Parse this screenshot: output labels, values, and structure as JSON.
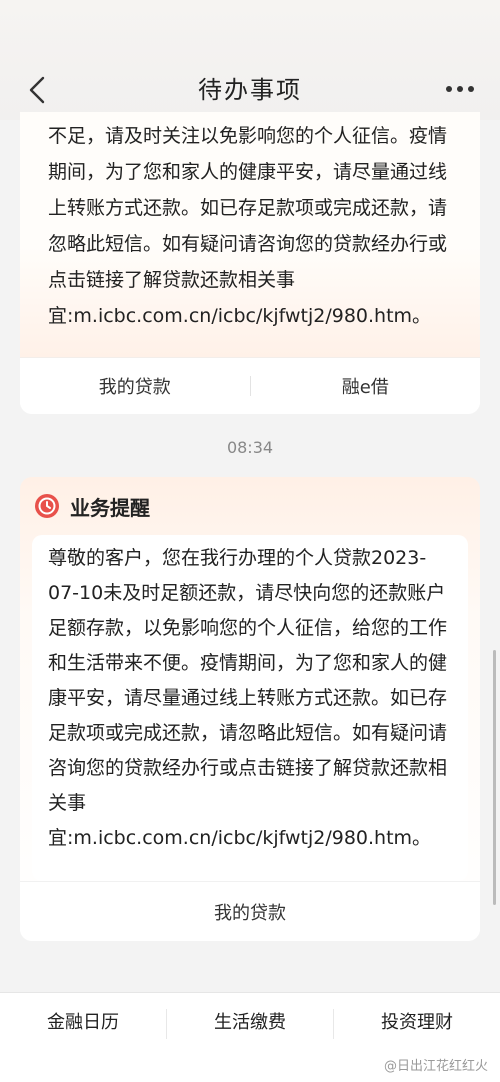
{
  "header": {
    "title": "待办事项"
  },
  "card1": {
    "text": "不足，请及时关注以免影响您的个人征信。疫情期间，为了您和家人的健康平安，请尽量通过线上转账方式还款。如已存足款项或完成还款，请忽略此短信。如有疑问请咨询您的贷款经办行或点击链接了解贷款还款相关事宜:m.icbc.com.cn/icbc/kjfwtj2/980.htm。",
    "actions": [
      "我的贷款",
      "融e借"
    ]
  },
  "timestamp": "08:34",
  "card2": {
    "label": "业务提醒",
    "text": "尊敬的客户，您在我行办理的个人贷款2023-07-10未及时足额还款，请尽快向您的还款账户足额存款，以免影响您的个人征信，给您的工作和生活带来不便。疫情期间，为了您和家人的健康平安，请尽量通过线上转账方式还款。如已存足款项或完成还款，请忽略此短信。如有疑问请咨询您的贷款经办行或点击链接了解贷款还款相关事宜:m.icbc.com.cn/icbc/kjfwtj2/980.htm。",
    "action": "我的贷款"
  },
  "tabs": [
    "金融日历",
    "生活缴费",
    "投资理财"
  ],
  "watermark": "@日出江花红红火",
  "icons": {
    "back": "chevron-left-icon",
    "more": "more-dots-icon",
    "reminder": "clock-icon"
  },
  "colors": {
    "accent": "#e8514b",
    "background": "#f3f3f3"
  }
}
